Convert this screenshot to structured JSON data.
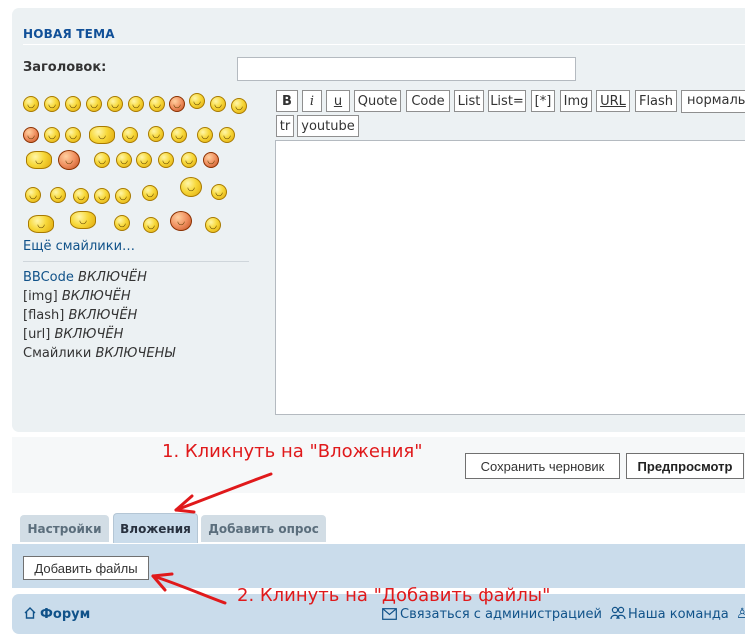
{
  "post_panel": {
    "title": "НОВАЯ ТЕМА",
    "subject_label": "Заголовок:",
    "subject_value": "",
    "more_smilies": "Ещё смайлики…",
    "status": {
      "bbcode_label": "BBCode",
      "bbcode_state": "ВКЛЮЧЁН",
      "img_label": "[img]",
      "img_state": "ВКЛЮЧЁН",
      "flash_label": "[flash]",
      "flash_state": "ВКЛЮЧЁН",
      "url_label": "[url]",
      "url_state": "ВКЛЮЧЁН",
      "smilies_label": "Смайлики",
      "smilies_state": "ВКЛЮЧЕНЫ"
    }
  },
  "toolbar": {
    "bold": "B",
    "italic": "i",
    "underline": "u",
    "quote": "Quote",
    "code": "Code",
    "list": "List",
    "list_eq": "List=",
    "list_item": "[*]",
    "img": "Img",
    "url": "URL",
    "flash": "Flash",
    "font_size": "нормальный",
    "tr": "tr",
    "youtube": "youtube"
  },
  "buttons": {
    "save_draft": "Сохранить черновик",
    "preview": "Предпросмотр",
    "add_files": "Добавить файлы"
  },
  "tabs": {
    "settings": "Настройки",
    "attachments": "Вложения",
    "add_poll": "Добавить опрос"
  },
  "navbar": {
    "forum": "Форум",
    "contact": "Связаться с администрацией",
    "team": "Наша команда"
  },
  "annotations": {
    "step1": "1. Кликнуть на \"Вложения\"",
    "step2": "2. Клинуть на \"Добавить файлы\""
  },
  "colors": {
    "link": "#105289",
    "panel": "#ecf1f3",
    "tab_active": "#cadceb",
    "annotation": "#e0191b"
  }
}
